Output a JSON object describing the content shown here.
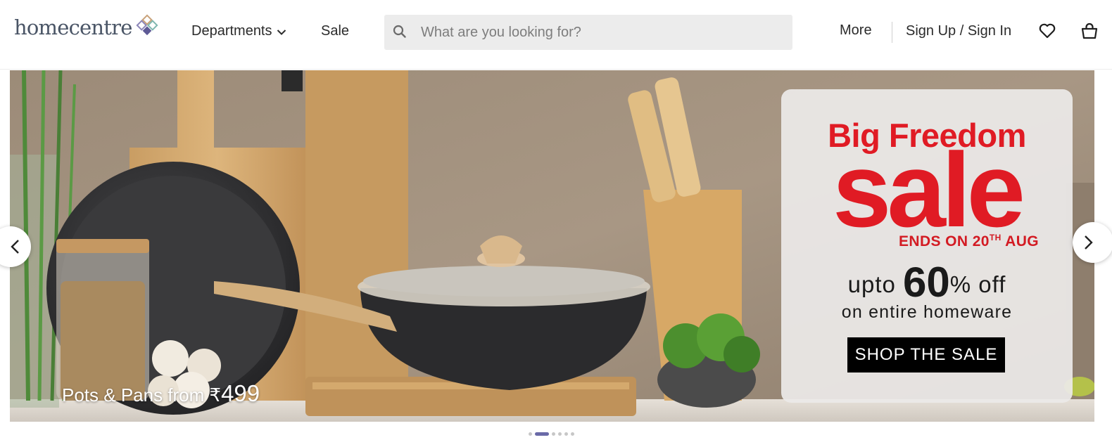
{
  "header": {
    "logo_text": "homecentre",
    "nav": {
      "departments": "Departments",
      "sale": "Sale",
      "more": "More",
      "signin": "Sign Up / Sign In"
    },
    "search": {
      "placeholder": "What are you looking for?",
      "value": ""
    },
    "icons": [
      "search-icon",
      "chevron-down-icon",
      "heart-icon",
      "shopping-bag-icon"
    ]
  },
  "banner": {
    "promo": {
      "title": "Big Freedom",
      "big": "sale",
      "ends_prefix": "ENDS ON 20",
      "ends_sup": "TH",
      "ends_suffix": " AUG",
      "upto": "upto",
      "percent": "60",
      "off": "% off",
      "entire": "on entire homeware",
      "cta": "SHOP THE SALE"
    },
    "caption": "Pots & Pans from ₹",
    "caption_price": "499",
    "carousel": {
      "total_slides": 6,
      "active_index": 1
    }
  },
  "colors": {
    "sale_red": "#e01b24",
    "cta_bg": "#000000",
    "dot_active": "#6a6aa8",
    "search_bg": "#ececec"
  }
}
